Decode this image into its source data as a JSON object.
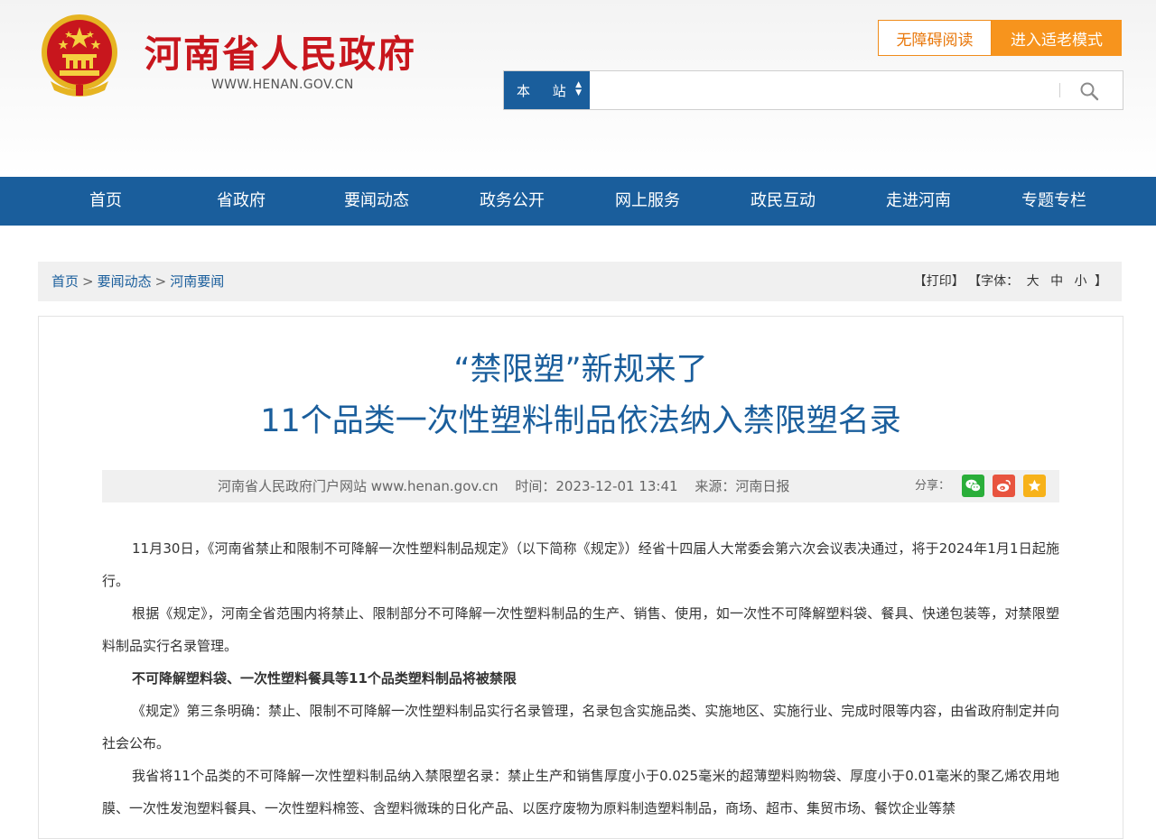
{
  "header": {
    "site_name": "河南省人民政府",
    "site_url": "WWW.HENAN.GOV.CN",
    "btn_accessible": "无障碍阅读",
    "btn_elder": "进入适老模式",
    "search": {
      "scope_label": "本 站",
      "placeholder": "",
      "value": ""
    }
  },
  "nav": {
    "items": [
      "首页",
      "省政府",
      "要闻动态",
      "政务公开",
      "网上服务",
      "政民互动",
      "走进河南",
      "专题专栏"
    ]
  },
  "breadcrumb": {
    "items": [
      "首页",
      "要闻动态",
      "河南要闻"
    ],
    "separator": ">"
  },
  "tools": {
    "print": "【打印】",
    "font_prefix": "【字体：",
    "font_large": "大",
    "font_medium": "中",
    "font_small": "小",
    "font_suffix": "】"
  },
  "article": {
    "title_line1": "“禁限塑”新规来了",
    "title_line2": "11个品类一次性塑料制品依法纳入禁限塑名录",
    "meta": {
      "site": "河南省人民政府门户网站 www.henan.gov.cn",
      "time": "时间：2023-12-01 13:41",
      "source": "来源：河南日报",
      "share_label": "分享："
    },
    "paragraphs": [
      "11月30日，《河南省禁止和限制不可降解一次性塑料制品规定》（以下简称《规定》）经省十四届人大常委会第六次会议表决通过，将于2024年1月1日起施行。",
      "根据《规定》，河南全省范围内将禁止、限制部分不可降解一次性塑料制品的生产、销售、使用，如一次性不可降解塑料袋、餐具、快递包装等，对禁限塑料制品实行名录管理。",
      "不可降解塑料袋、一次性塑料餐具等11个品类塑料制品将被禁限",
      "《规定》第三条明确：禁止、限制不可降解一次性塑料制品实行名录管理，名录包含实施品类、实施地区、实施行业、完成时限等内容，由省政府制定并向社会公布。",
      "我省将11个品类的不可降解一次性塑料制品纳入禁限塑名录：禁止生产和销售厚度小于0.025毫米的超薄塑料购物袋、厚度小于0.01毫米的聚乙烯农用地膜、一次性发泡塑料餐具、一次性塑料棉签、含塑料微珠的日化产品、以医疗废物为原料制造塑料制品，商场、超市、集贸市场、餐饮企业等禁"
    ]
  },
  "colors": {
    "brand_red": "#c8161d",
    "nav_blue": "#1a5e9c",
    "accent_orange": "#f7941d"
  }
}
